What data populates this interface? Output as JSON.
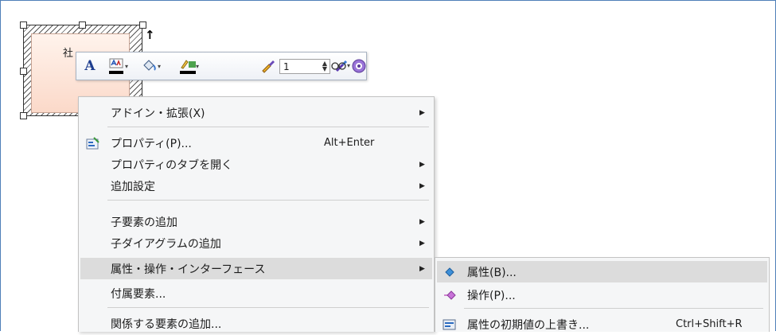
{
  "diagram": {
    "element_label": "社",
    "direction_glyph": "↑"
  },
  "toolbar": {
    "font_glyph": "A",
    "line_width_value": "1",
    "spin_up_glyph": "▲",
    "spin_down_glyph": "▼",
    "caret_glyph": "▾"
  },
  "context_menu": {
    "submenu_arrow": "▶",
    "items": [
      {
        "label": "アドイン・拡張(X)",
        "shortcut": "",
        "has_submenu": true
      },
      {
        "label": "プロパティ(P)...",
        "shortcut": "Alt+Enter",
        "has_submenu": false
      },
      {
        "label": "プロパティのタブを開く",
        "shortcut": "",
        "has_submenu": true
      },
      {
        "label": "追加設定",
        "shortcut": "",
        "has_submenu": true
      },
      {
        "label": "子要素の追加",
        "shortcut": "",
        "has_submenu": true
      },
      {
        "label": "子ダイアグラムの追加",
        "shortcut": "",
        "has_submenu": true
      },
      {
        "label": "属性・操作・インターフェース",
        "shortcut": "",
        "has_submenu": true,
        "highlighted": true
      },
      {
        "label": "付属要素...",
        "shortcut": "",
        "has_submenu": false
      },
      {
        "label": "関係する要素の追加...",
        "shortcut": "",
        "has_submenu": false
      }
    ]
  },
  "submenu": {
    "items": [
      {
        "label": "属性(B)...",
        "shortcut": "",
        "highlighted": true
      },
      {
        "label": "操作(P)...",
        "shortcut": ""
      },
      {
        "label": "属性の初期値の上書き...",
        "shortcut": "Ctrl+Shift+R"
      }
    ]
  },
  "colors": {
    "accent_border": "#4f7fb8",
    "menu_background": "#f5f6f7",
    "menu_highlight": "#dcdcdc",
    "element_fill": "#fbd9c9"
  }
}
